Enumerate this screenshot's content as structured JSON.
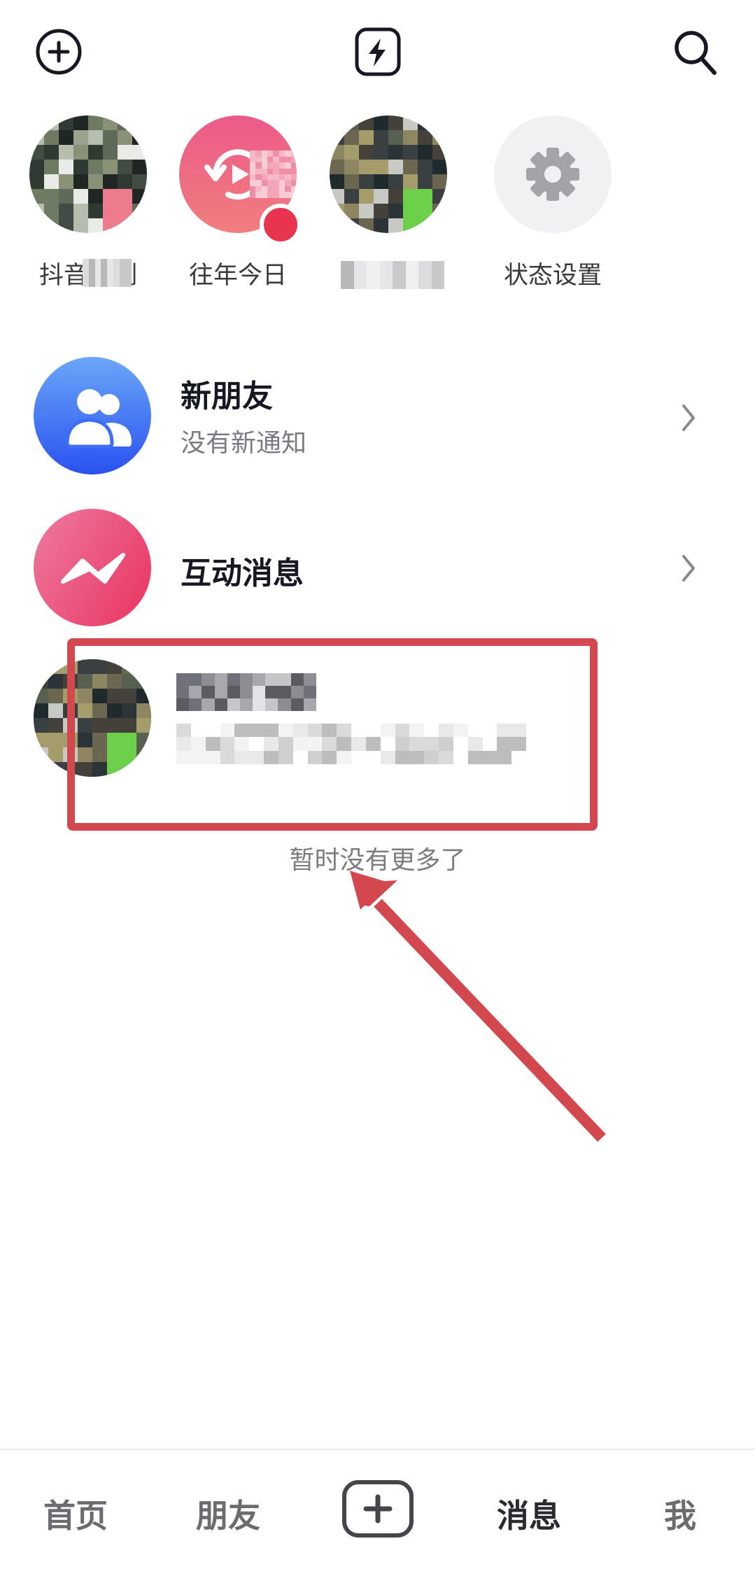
{
  "top_bar": {
    "left_icon": "add-circle-icon",
    "center_icon": "flash-icon",
    "right_icon": "search-icon"
  },
  "stories": [
    {
      "label": "抖音时刻",
      "type": "avatar-pixelated",
      "badge": "red"
    },
    {
      "label": "往年今日",
      "type": "memories-icon",
      "badge": "red"
    },
    {
      "label": "",
      "type": "avatar-pixelated",
      "badge": "green"
    },
    {
      "label": "状态设置",
      "type": "gear-icon"
    }
  ],
  "list": {
    "new_friends": {
      "title": "新朋友",
      "subtitle": "没有新通知"
    },
    "interactions": {
      "title": "互动消息"
    },
    "conversation": {
      "title": "",
      "preview": "",
      "online": true
    }
  },
  "end_text": "暂时没有更多了",
  "annotation": {
    "color": "#d3484e"
  },
  "bottom_nav": {
    "items": [
      "首页",
      "朋友",
      "消息",
      "我"
    ],
    "active": "消息",
    "create_icon": "plus-square-icon"
  },
  "colors": {
    "text_primary": "#161823",
    "text_secondary": "#7a7a80",
    "new_friends_gradient": [
      "#6aa6f8",
      "#2a52f0"
    ],
    "interactions_gradient": [
      "#ee7aa0",
      "#e8345f"
    ],
    "memories_gradient": [
      "#ec5c8a",
      "#f07e7e"
    ],
    "settings_bg": "#f1f1f3",
    "gear": "#a4a4a8"
  }
}
